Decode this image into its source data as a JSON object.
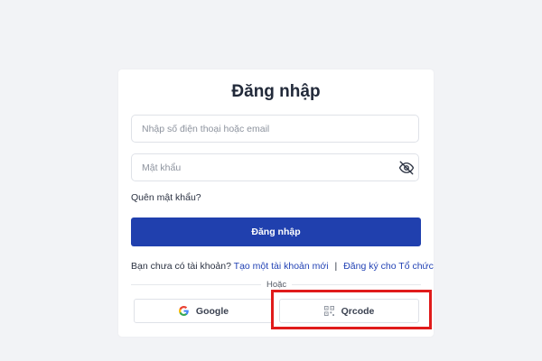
{
  "login": {
    "title": "Đăng nhập",
    "phone_placeholder": "Nhập số điện thoại hoặc email",
    "password_placeholder": "Mật khẩu",
    "forgot_password": "Quên mật khẩu?",
    "submit_label": "Đăng nhập",
    "no_account_text": "Bạn chưa có tài khoản?",
    "create_account_link": "Tạo một tài khoản mới",
    "separator": "|",
    "org_register_link": "Đăng ký cho Tổ chức",
    "or_text": "Hoặc",
    "google_label": "Google",
    "qrcode_label": "Qrcode"
  },
  "colors": {
    "primary": "#2040ae",
    "link": "#2343b5",
    "highlight": "#e01b1b",
    "background": "#f2f3f6"
  },
  "icons": {
    "password_toggle": "eye-slash-icon",
    "google": "google-icon",
    "qrcode": "qrcode-icon"
  }
}
